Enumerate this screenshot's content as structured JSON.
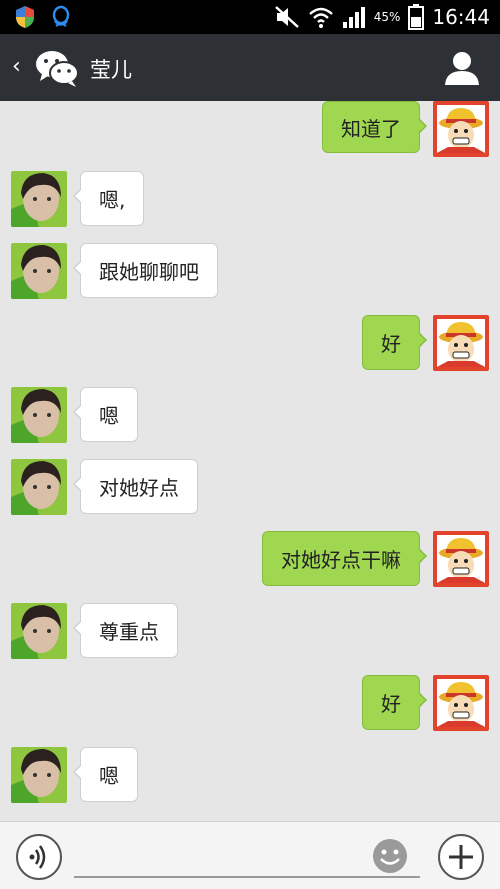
{
  "status_bar": {
    "battery_percent": "45%",
    "time": "16:44"
  },
  "header": {
    "back_label": "‹",
    "title": "莹儿"
  },
  "messages": [
    {
      "side": "right",
      "text": "知道了"
    },
    {
      "side": "left",
      "text": "嗯,"
    },
    {
      "side": "left",
      "text": "跟她聊聊吧"
    },
    {
      "side": "right",
      "text": "好"
    },
    {
      "side": "left",
      "text": "嗯"
    },
    {
      "side": "left",
      "text": "对她好点"
    },
    {
      "side": "right",
      "text": "对她好点干嘛"
    },
    {
      "side": "left",
      "text": "尊重点"
    },
    {
      "side": "right",
      "text": "好"
    },
    {
      "side": "left",
      "text": "嗯"
    }
  ],
  "input": {
    "value": "",
    "placeholder": ""
  },
  "colors": {
    "header_bg": "#2d3135",
    "chat_bg": "#e6e6e6",
    "sent_bubble": "#9fd750",
    "received_bubble": "#ffffff"
  },
  "icons": [
    "app-store-icon",
    "qq-icon",
    "mute-icon",
    "wifi-icon",
    "signal-icon",
    "battery-icon",
    "back-icon",
    "wechat-icon",
    "profile-icon",
    "voice-icon",
    "emoji-icon",
    "plus-icon"
  ]
}
